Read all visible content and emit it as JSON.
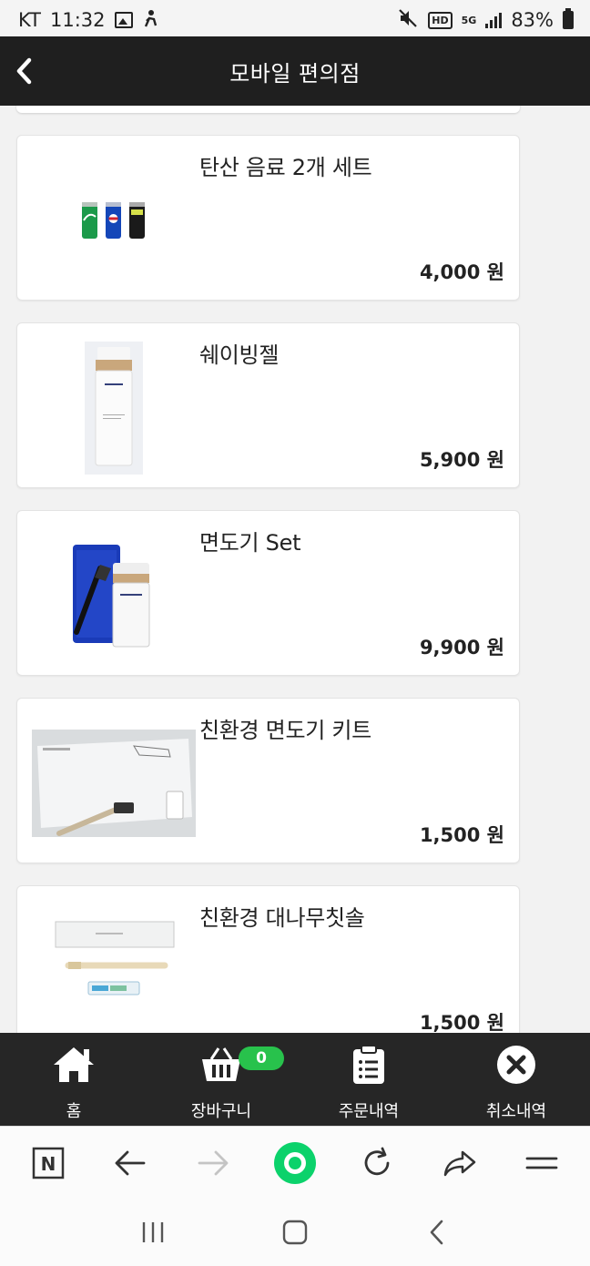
{
  "status_bar": {
    "carrier": "KT",
    "time": "11:32",
    "network": "5G",
    "quality": "HD",
    "battery": "83%"
  },
  "header": {
    "title": "모바일 편의점",
    "back_icon": "chevron-left-icon"
  },
  "products": [
    {
      "name": "탄산 음료 2개 세트",
      "price": "4,000 원",
      "thumb": "soda-cans"
    },
    {
      "name": "쉐이빙젤",
      "price": "5,900 원",
      "thumb": "shaving-gel-bottle"
    },
    {
      "name": "면도기 Set",
      "price": "9,900 원",
      "thumb": "razor-set"
    },
    {
      "name": "친환경 면도기 키트",
      "price": "1,500 원",
      "thumb": "eco-razor-kit"
    },
    {
      "name": "친환경 대나무칫솔",
      "price": "1,500 원",
      "thumb": "bamboo-toothbrush-kit"
    }
  ],
  "tabbar": {
    "home": {
      "label": "홈",
      "icon": "home-icon"
    },
    "cart": {
      "label": "장바구니",
      "icon": "basket-icon",
      "count": "0"
    },
    "orders": {
      "label": "주문내역",
      "icon": "clipboard-icon"
    },
    "cancel": {
      "label": "취소내역",
      "icon": "x-circle-icon"
    }
  },
  "browser_toolbar": {
    "logo": "N",
    "icons": [
      "naver-logo-icon",
      "back-arrow-icon",
      "forward-arrow-icon",
      "green-dot-icon",
      "refresh-icon",
      "share-icon",
      "menu-icon"
    ]
  },
  "colors": {
    "header_bg": "#1f1f1f",
    "tabbar_bg": "#262626",
    "badge_green": "#28c24c",
    "page_bg": "#f2f2f2"
  }
}
